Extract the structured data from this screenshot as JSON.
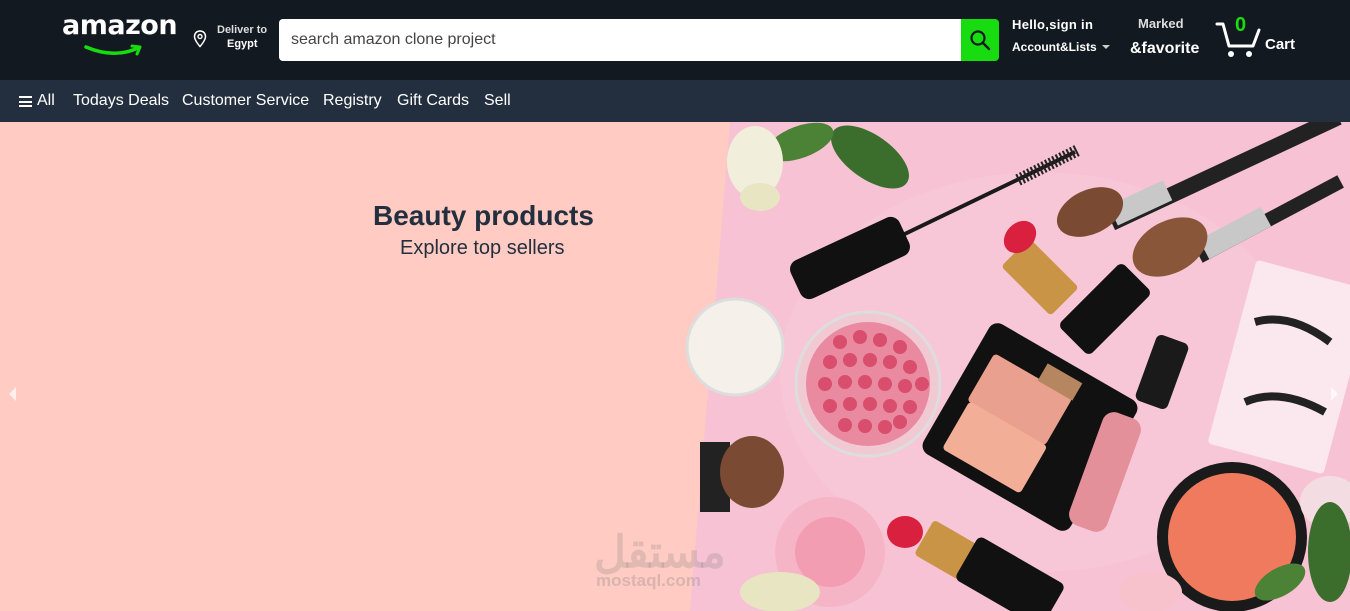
{
  "header": {
    "logo_text": "amazon",
    "deliver_line1": "Deliver to",
    "deliver_line2": "Egypt",
    "search_placeholder": "search amazon clone project",
    "account_line1": "Hello,sign in",
    "account_line2": "Account&Lists",
    "marked_line1": "Marked",
    "marked_line2": "&favorite",
    "cart_count": "0",
    "cart_label": "Cart"
  },
  "nav": {
    "all": "All",
    "items": [
      "Todays Deals",
      "Customer Service",
      "Registry",
      "Gift Cards",
      "Sell"
    ]
  },
  "hero": {
    "title": "Beauty products",
    "subtitle": "Explore top sellers",
    "watermark_arabic": "مستقل",
    "watermark_latin": "mostaql.com"
  },
  "colors": {
    "header_bg": "#131921",
    "nav_bg": "#232f3e",
    "accent_green": "#17dd10",
    "hero_bg": "#ffcbc2",
    "smile_green": "#17dd10"
  },
  "icons": {
    "location": "map-pin-icon",
    "search": "search-icon",
    "cart": "cart-icon",
    "menu": "hamburger-icon"
  }
}
